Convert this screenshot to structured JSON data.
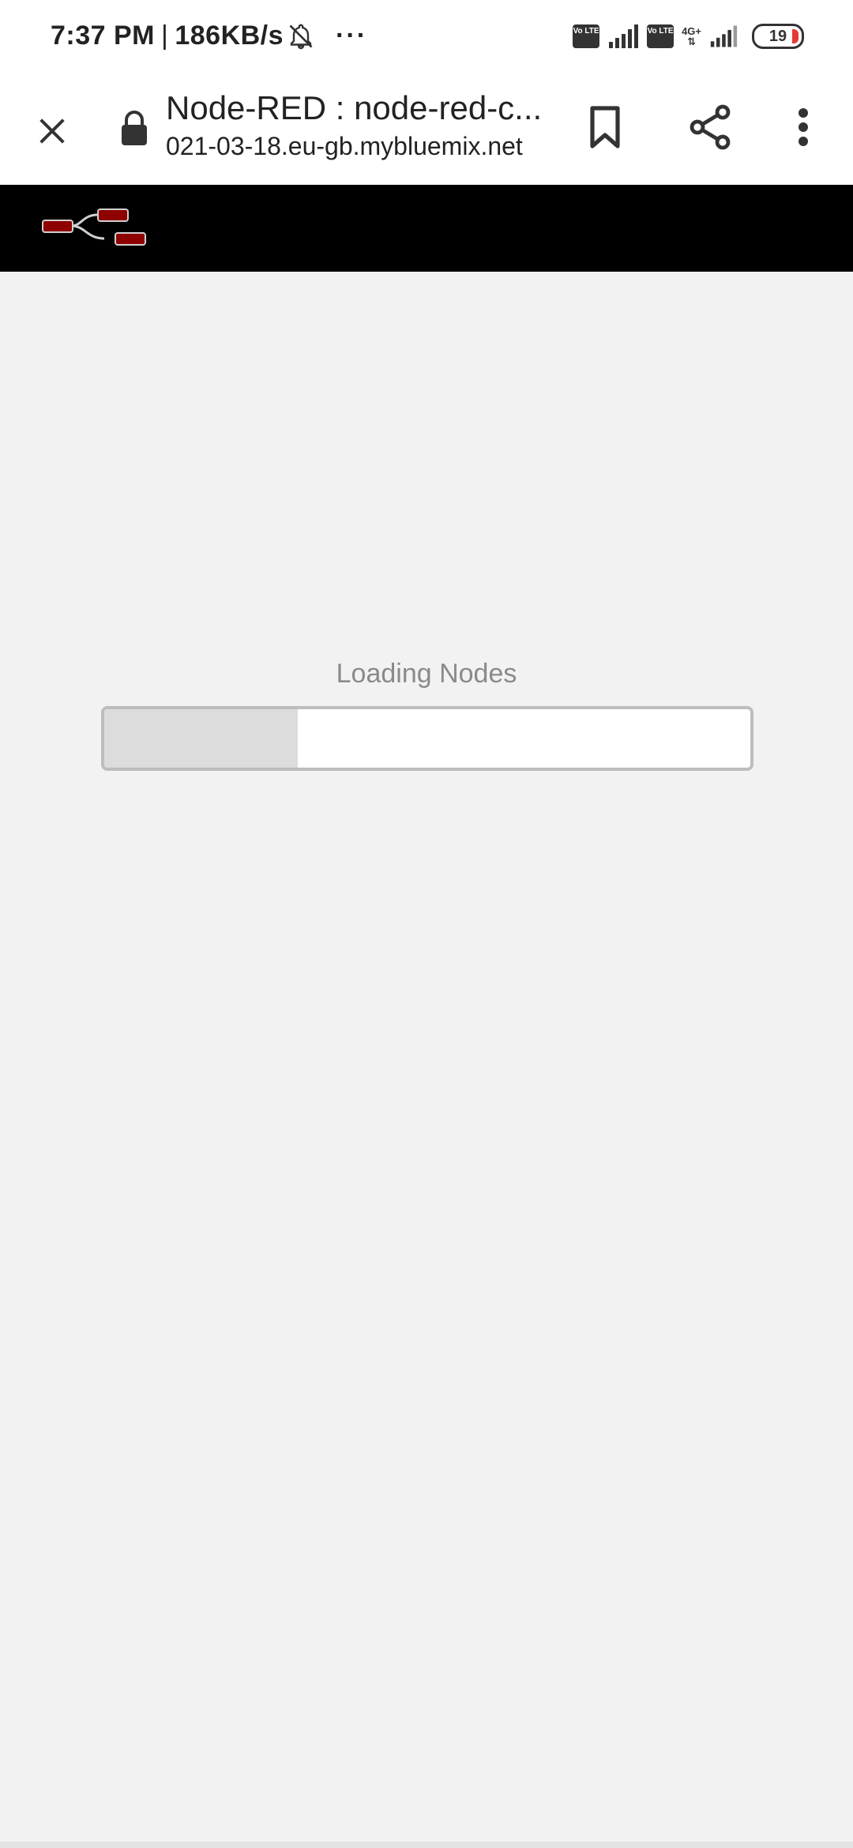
{
  "status_bar": {
    "time": "7:37 PM",
    "separator": "|",
    "speed": "186KB/s",
    "more_indicator": "···",
    "volte_1": "Vo LTE",
    "volte_2": "Vo LTE",
    "network_type": "4G+",
    "battery_level": "19",
    "icons": [
      "mute-icon",
      "signal-icon",
      "signal-icon",
      "battery-icon"
    ]
  },
  "browser": {
    "title": "Node-RED : node-red-c...",
    "url": "021-03-18.eu-gb.mybluemix.net",
    "icons": [
      "close-icon",
      "lock-icon",
      "bookmark-icon",
      "share-icon",
      "more-vert-icon"
    ]
  },
  "node_red": {
    "logo": "node-red-logo",
    "header_color": "#000000",
    "node_color": "#8f0000"
  },
  "loading": {
    "label": "Loading Nodes",
    "progress": 0.3
  }
}
